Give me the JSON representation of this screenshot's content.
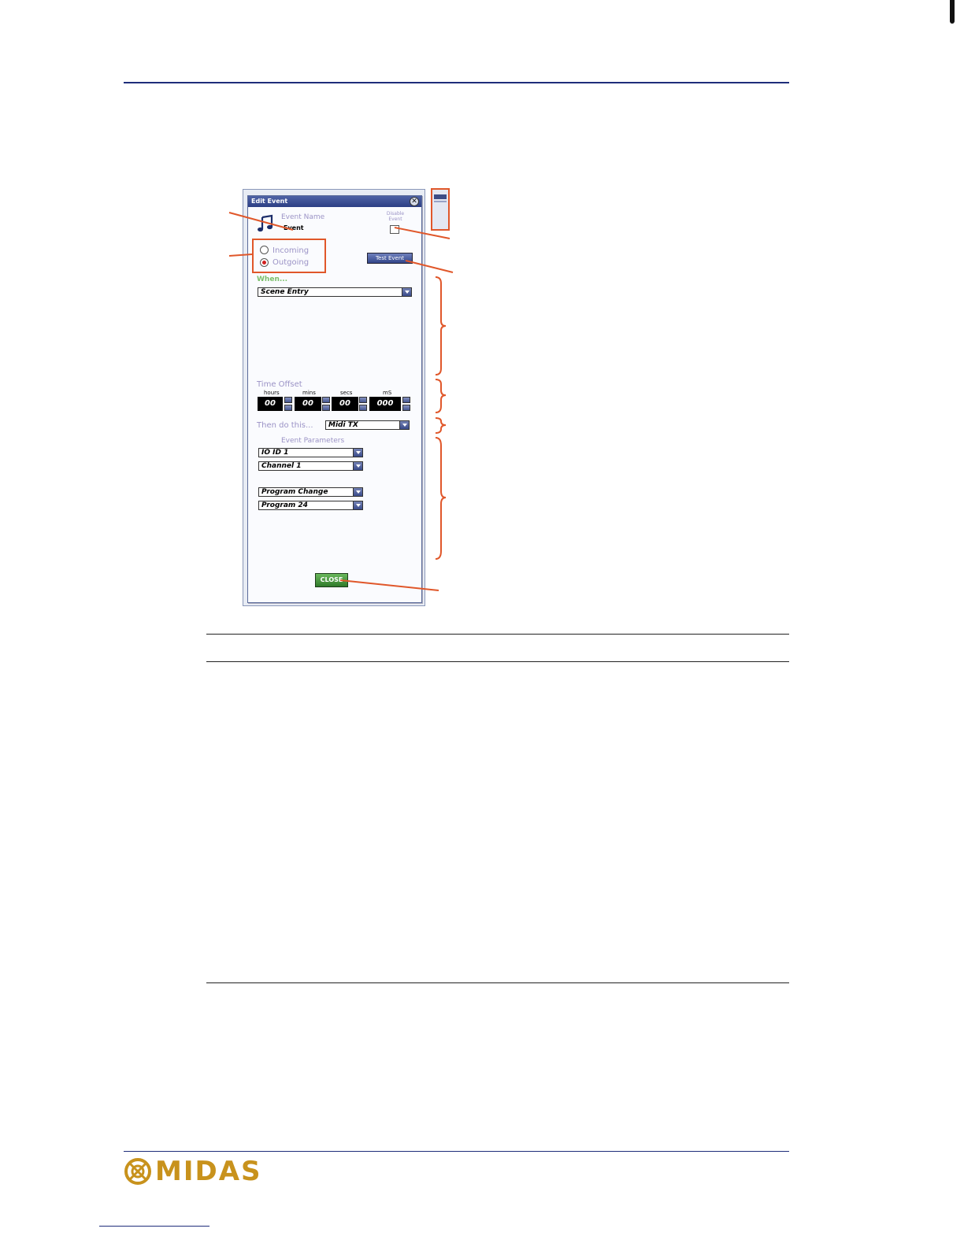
{
  "dialog": {
    "title": "Edit Event",
    "close_glyph": "✕",
    "event_name_label": "Event Name",
    "event_name_value": "Event",
    "disable_event_label_1": "Disable",
    "disable_event_label_2": "Event",
    "direction_options": [
      "Incoming",
      "Outgoing"
    ],
    "selected_direction": "Outgoing",
    "test_button_label": "Test Event",
    "when_label": "When...",
    "when_value": "Scene Entry",
    "time_offset_label": "Time Offset",
    "time_units": [
      "hours",
      "mins",
      "secs",
      "mS"
    ],
    "time_values": [
      "00",
      "00",
      "00",
      "000"
    ],
    "then_label": "Then do this...",
    "then_value": "Midi TX",
    "event_parameters_label": "Event Parameters",
    "param_1": "IO ID 1",
    "param_2": "Channel 1",
    "param_3": "Program Change",
    "param_4": "Program 24",
    "close_button_label": "CLOSE",
    "event_icon": "music-note-icon"
  },
  "footer": {
    "logo_text": "MIDAS"
  },
  "colors": {
    "callout": "#e0572a",
    "rule": "#1e2d7a",
    "logo_gold": "#c8921c"
  }
}
